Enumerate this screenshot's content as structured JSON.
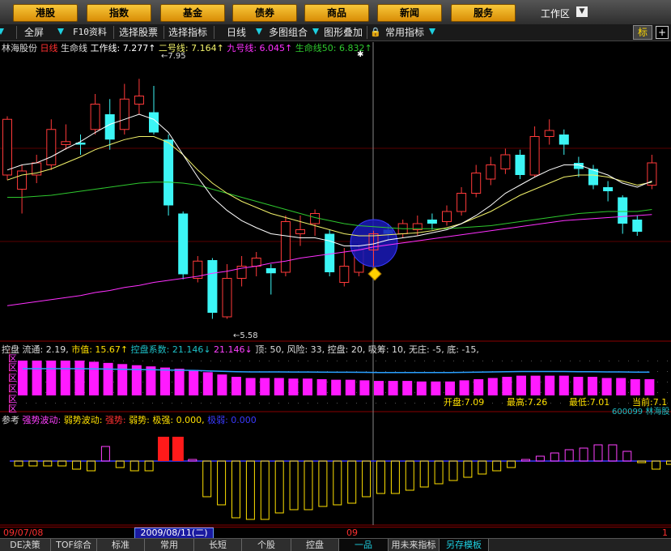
{
  "nav": {
    "buttons": [
      "港股",
      "指数",
      "基金",
      "债券",
      "商品",
      "新闻",
      "服务"
    ],
    "workzone": "工作区"
  },
  "toolbar": {
    "items": [
      "全屏",
      "F10资料",
      "选择股票",
      "选择指标",
      "日线",
      "多图组合",
      "图形叠加",
      "常用指标"
    ],
    "biao": "标",
    "plus": "+"
  },
  "main_legend": {
    "stock": "林海股份",
    "period": "日线",
    "indicator": "生命线",
    "work_line": "工作线: 7.277↑",
    "line2": "二号线: 7.164↑",
    "line9": "九号线: 6.045↑",
    "life50": "生命线50: 6.832↑"
  },
  "price_labels": {
    "high": "7.95",
    "low": "5.58"
  },
  "panel2": {
    "title": "控盘",
    "liutong": "流通: 2.19,",
    "shizhi": "市值: 15.67↑",
    "kongpan_xishu": "控盘系数: 21.146↓",
    "val2": "21.146↓",
    "rest": "顶: 50, 风险: 33, 控盘: 20, 吸筹: 10, 无庄: -5, 底: -15,",
    "zones": [
      "区",
      "区",
      "区",
      "区",
      "区",
      "区"
    ],
    "stats": {
      "open": "开盘:7.09",
      "high": "最高:7.26",
      "low": "最低:7.01",
      "cur": "当前:7.1"
    },
    "code": "600099  林海股"
  },
  "panel3": {
    "title": "参考",
    "strong_wave": "强势波动:",
    "weak_wave": "弱势波动:",
    "strong": "强势:",
    "weak": "弱势:",
    "extreme": "极强: 0.000,",
    "extreme_weak": "极弱: 0.000"
  },
  "dates": {
    "d1": "09/07/08",
    "selected": "2009/08/11(二)",
    "d2": "09",
    "d3": "1"
  },
  "tabs": [
    "DE决策",
    "TOF综合",
    "标准",
    "常用",
    "长短",
    "个股",
    "控盘",
    "一品",
    "用未来指标",
    "另存模板"
  ],
  "colors": {
    "up": "#ff3a3a",
    "down": "#3cf5f5",
    "work": "#ffffff",
    "line2": "#f2f26a",
    "line9": "#ff30ff",
    "life": "#2ec82e"
  },
  "chart_data": {
    "type": "candlestick",
    "candles": [
      {
        "o": 7.0,
        "c": 7.55,
        "h": 7.58,
        "l": 6.95
      },
      {
        "o": 6.86,
        "c": 7.04,
        "h": 7.1,
        "l": 6.62
      },
      {
        "o": 7.0,
        "c": 7.12,
        "h": 7.2,
        "l": 6.92
      },
      {
        "o": 7.1,
        "c": 7.45,
        "h": 7.55,
        "l": 7.05
      },
      {
        "o": 7.3,
        "c": 7.33,
        "h": 7.5,
        "l": 7.25
      },
      {
        "o": 7.32,
        "c": 7.3,
        "h": 7.4,
        "l": 7.2
      },
      {
        "o": 7.45,
        "c": 7.7,
        "h": 7.8,
        "l": 7.4
      },
      {
        "o": 7.6,
        "c": 7.35,
        "h": 7.75,
        "l": 7.25
      },
      {
        "o": 7.45,
        "c": 7.75,
        "h": 7.9,
        "l": 7.4
      },
      {
        "o": 7.7,
        "c": 7.78,
        "h": 7.95,
        "l": 7.6
      },
      {
        "o": 7.62,
        "c": 7.42,
        "h": 7.88,
        "l": 7.4
      },
      {
        "o": 7.35,
        "c": 6.7,
        "h": 7.4,
        "l": 6.6
      },
      {
        "o": 6.62,
        "c": 6.02,
        "h": 6.64,
        "l": 5.97
      },
      {
        "o": 5.98,
        "c": 6.15,
        "h": 6.2,
        "l": 5.94
      },
      {
        "o": 6.16,
        "c": 5.64,
        "h": 6.18,
        "l": 5.58
      },
      {
        "o": 5.6,
        "c": 5.98,
        "h": 6.12,
        "l": 5.58
      },
      {
        "o": 5.98,
        "c": 6.1,
        "h": 6.2,
        "l": 5.9
      },
      {
        "o": 6.1,
        "c": 6.18,
        "h": 6.24,
        "l": 6.0
      },
      {
        "o": 6.08,
        "c": 6.03,
        "h": 6.12,
        "l": 5.82
      },
      {
        "o": 6.04,
        "c": 6.54,
        "h": 6.6,
        "l": 6.0
      },
      {
        "o": 6.42,
        "c": 6.46,
        "h": 6.6,
        "l": 6.3
      },
      {
        "o": 6.52,
        "c": 6.62,
        "h": 6.66,
        "l": 6.4
      },
      {
        "o": 6.42,
        "c": 6.04,
        "h": 6.46,
        "l": 6.0
      },
      {
        "o": 5.94,
        "c": 6.1,
        "h": 6.28,
        "l": 5.9
      },
      {
        "o": 6.04,
        "c": 6.26,
        "h": 6.32,
        "l": 6.0
      },
      {
        "o": 6.26,
        "c": 6.42,
        "h": 6.45,
        "l": 6.1
      },
      {
        "o": 6.46,
        "c": 6.42,
        "h": 6.52,
        "l": 6.35
      },
      {
        "o": 6.42,
        "c": 6.52,
        "h": 6.56,
        "l": 6.38
      },
      {
        "o": 6.46,
        "c": 6.52,
        "h": 6.6,
        "l": 6.4
      },
      {
        "o": 6.56,
        "c": 6.52,
        "h": 6.62,
        "l": 6.46
      },
      {
        "o": 6.54,
        "c": 6.64,
        "h": 6.7,
        "l": 6.5
      },
      {
        "o": 6.64,
        "c": 6.82,
        "h": 6.88,
        "l": 6.6
      },
      {
        "o": 6.82,
        "c": 7.02,
        "h": 7.1,
        "l": 6.78
      },
      {
        "o": 6.96,
        "c": 7.1,
        "h": 7.18,
        "l": 6.9
      },
      {
        "o": 7.06,
        "c": 7.2,
        "h": 7.26,
        "l": 7.01
      },
      {
        "o": 7.2,
        "c": 7.0,
        "h": 7.25,
        "l": 6.96
      },
      {
        "o": 7.0,
        "c": 7.38,
        "h": 7.48,
        "l": 6.98
      },
      {
        "o": 7.38,
        "c": 7.44,
        "h": 7.55,
        "l": 7.3
      },
      {
        "o": 7.4,
        "c": 7.3,
        "h": 7.45,
        "l": 7.2
      },
      {
        "o": 7.12,
        "c": 7.06,
        "h": 7.18,
        "l": 6.98
      },
      {
        "o": 7.06,
        "c": 6.9,
        "h": 7.1,
        "l": 6.86
      },
      {
        "o": 6.88,
        "c": 6.84,
        "h": 6.94,
        "l": 6.74
      },
      {
        "o": 6.78,
        "c": 6.52,
        "h": 6.8,
        "l": 6.42
      },
      {
        "o": 6.56,
        "c": 6.44,
        "h": 6.6,
        "l": 6.4
      },
      {
        "o": 6.9,
        "c": 7.12,
        "h": 7.2,
        "l": 6.86
      }
    ],
    "work_line": [
      7.05,
      7.1,
      7.12,
      7.18,
      7.26,
      7.33,
      7.42,
      7.5,
      7.55,
      7.6,
      7.55,
      7.42,
      7.2,
      6.98,
      6.78,
      6.65,
      6.55,
      6.48,
      6.42,
      6.4,
      6.38,
      6.38,
      6.35,
      6.3,
      6.3,
      6.32,
      6.36,
      6.38,
      6.4,
      6.43,
      6.46,
      6.52,
      6.6,
      6.7,
      6.82,
      6.9,
      6.98,
      7.05,
      7.1,
      7.1,
      7.05,
      7.0,
      6.92,
      6.88,
      6.94
    ],
    "line2": [
      6.95,
      7.0,
      7.02,
      7.06,
      7.12,
      7.18,
      7.25,
      7.3,
      7.35,
      7.38,
      7.38,
      7.32,
      7.2,
      7.05,
      6.92,
      6.82,
      6.74,
      6.68,
      6.62,
      6.58,
      6.54,
      6.5,
      6.46,
      6.42,
      6.4,
      6.4,
      6.41,
      6.42,
      6.43,
      6.45,
      6.48,
      6.52,
      6.58,
      6.64,
      6.72,
      6.8,
      6.86,
      6.92,
      6.98,
      7.0,
      7.0,
      6.98,
      6.94,
      6.9,
      6.93
    ],
    "life50": [
      6.78,
      6.78,
      6.79,
      6.8,
      6.82,
      6.84,
      6.86,
      6.88,
      6.9,
      6.92,
      6.93,
      6.93,
      6.92,
      6.9,
      6.86,
      6.82,
      6.78,
      6.74,
      6.7,
      6.66,
      6.62,
      6.58,
      6.55,
      6.52,
      6.5,
      6.49,
      6.48,
      6.47,
      6.47,
      6.47,
      6.47,
      6.48,
      6.49,
      6.5,
      6.52,
      6.54,
      6.56,
      6.58,
      6.6,
      6.62,
      6.63,
      6.64,
      6.64,
      6.64,
      6.66
    ],
    "line9": [
      5.71,
      5.73,
      5.75,
      5.77,
      5.79,
      5.81,
      5.84,
      5.86,
      5.89,
      5.91,
      5.94,
      5.96,
      5.98,
      6.0,
      6.03,
      6.05,
      6.08,
      6.1,
      6.13,
      6.15,
      6.18,
      6.2,
      6.22,
      6.24,
      6.26,
      6.29,
      6.31,
      6.33,
      6.35,
      6.37,
      6.39,
      6.41,
      6.43,
      6.45,
      6.47,
      6.49,
      6.51,
      6.53,
      6.55,
      6.56,
      6.57,
      6.58,
      6.59,
      6.6,
      6.61
    ],
    "kongpan": [
      60,
      60,
      60,
      60,
      60,
      58,
      56,
      54,
      52,
      50,
      48,
      46,
      44,
      40,
      36,
      32,
      30,
      30,
      30,
      29,
      29,
      28,
      27,
      27,
      26,
      25,
      25,
      25,
      24,
      24,
      24,
      26,
      28,
      30,
      32,
      34,
      34,
      34,
      34,
      32,
      32,
      30,
      30,
      28,
      28
    ],
    "wave": [
      -3,
      -3,
      -3,
      -3,
      -5,
      -6,
      9,
      -4,
      -6,
      -6,
      15,
      15,
      1,
      -22,
      -27,
      -35,
      -36,
      -36,
      -32,
      -30,
      -30,
      -28,
      -27,
      -26,
      -22,
      -20,
      -20,
      -18,
      -16,
      -14,
      -12,
      -10,
      -8,
      -6,
      -4,
      1,
      3,
      5,
      7,
      8,
      10,
      10,
      6,
      -1,
      -5,
      -2
    ],
    "price_range": [
      5.4,
      8.2
    ]
  }
}
